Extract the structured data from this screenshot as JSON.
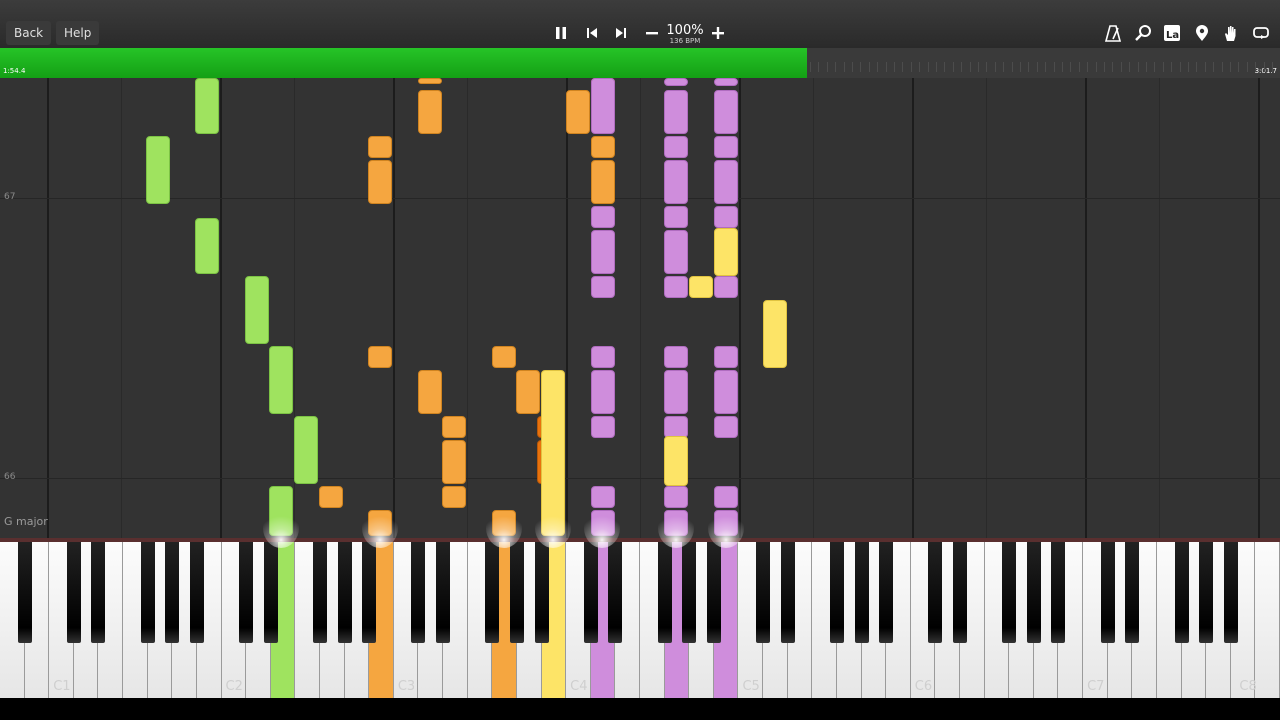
{
  "toolbar": {
    "back_label": "Back",
    "help_label": "Help",
    "speed_percent": "100%",
    "tempo": "136 BPM",
    "left_icons": [
      "pause-icon",
      "previous-icon",
      "next-icon",
      "minus-icon",
      "plus-icon"
    ],
    "right_icons": [
      "metronome-icon",
      "zoom-icon",
      "note-labels-icon",
      "bookmark-icon",
      "hand-icon",
      "loop-icon"
    ]
  },
  "progress": {
    "elapsed": "1:54.4",
    "total": "3:01.7",
    "fraction": 0.63,
    "color": "#1fb31f"
  },
  "roll": {
    "measures": [
      "67",
      "66"
    ],
    "key_signature": "G major",
    "colors": {
      "green": "#9fe35f",
      "orange": "#f5a640",
      "dark_orange": "#e8720c",
      "purple": "#cf8ddc",
      "yellow": "#fde467"
    }
  },
  "keyboard": {
    "octave_labels": [
      "C1",
      "C2",
      "C3",
      "C4",
      "C5",
      "C6",
      "C7",
      "C8"
    ],
    "pressed_colors": {
      "green": "#9fe35f",
      "orange": "#f5a640",
      "yellow": "#fde467",
      "purple": "#cf8ddc"
    }
  }
}
